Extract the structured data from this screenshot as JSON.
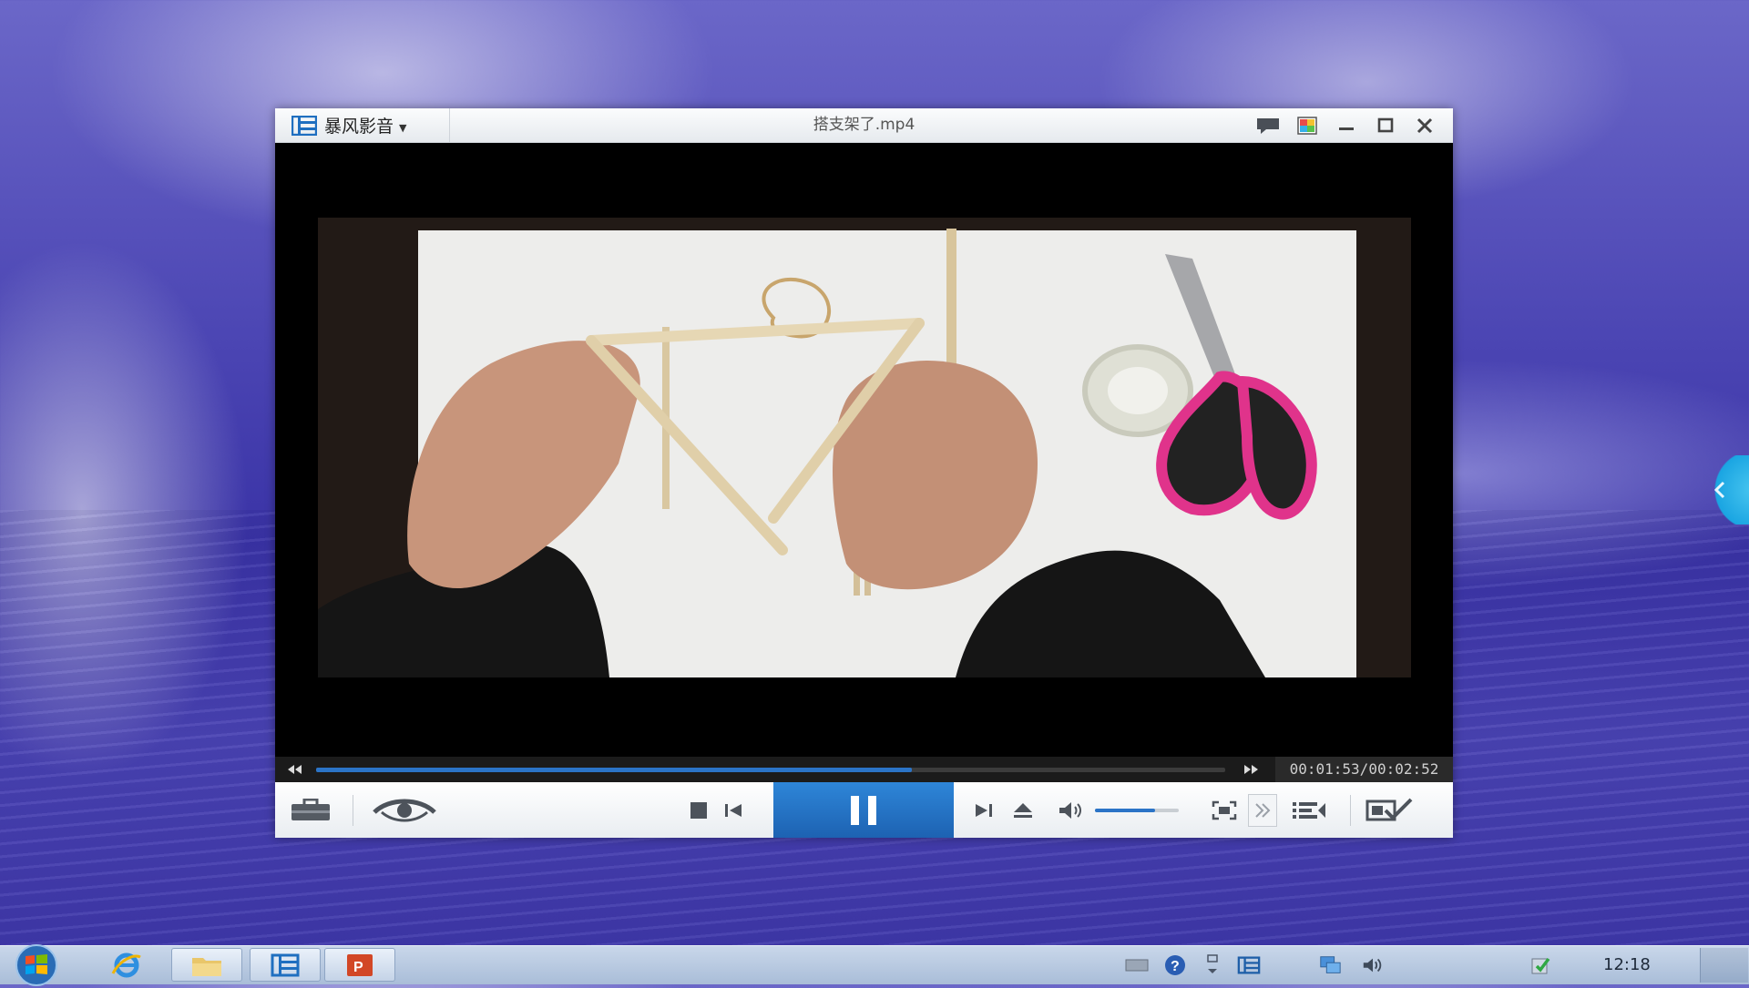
{
  "player": {
    "app_name": "暴风影音",
    "file_title": "搭支架了.mp4",
    "time_current": "00:01:53",
    "time_separator": "/",
    "time_total": "00:02:52",
    "progress_fraction": 0.655,
    "volume_fraction": 0.72,
    "accent_color": "#2b74c7"
  },
  "titlebar_icons": [
    "chat-bubble-icon",
    "color-palette-icon",
    "minimize-icon",
    "maximize-icon",
    "close-icon"
  ],
  "controls_icons": [
    "toolbox-icon",
    "eye-icon",
    "stop-icon",
    "previous-icon",
    "pause-icon",
    "next-icon",
    "eject-icon",
    "volume-icon",
    "fullscreen-icon",
    "expand-arrows-icon",
    "playlist-icon",
    "screenshot-check-icon"
  ],
  "taskbar": {
    "clock": "12:18",
    "tasks": [
      "internet-explorer-icon",
      "file-explorer-icon",
      "baofeng-player-icon",
      "powerpoint-icon"
    ],
    "tray": [
      "keyboard-icon",
      "help-icon",
      "tray-arrow-icon",
      "baofeng-tray-icon",
      "network-icon",
      "speaker-icon",
      "security-shield-icon"
    ]
  }
}
